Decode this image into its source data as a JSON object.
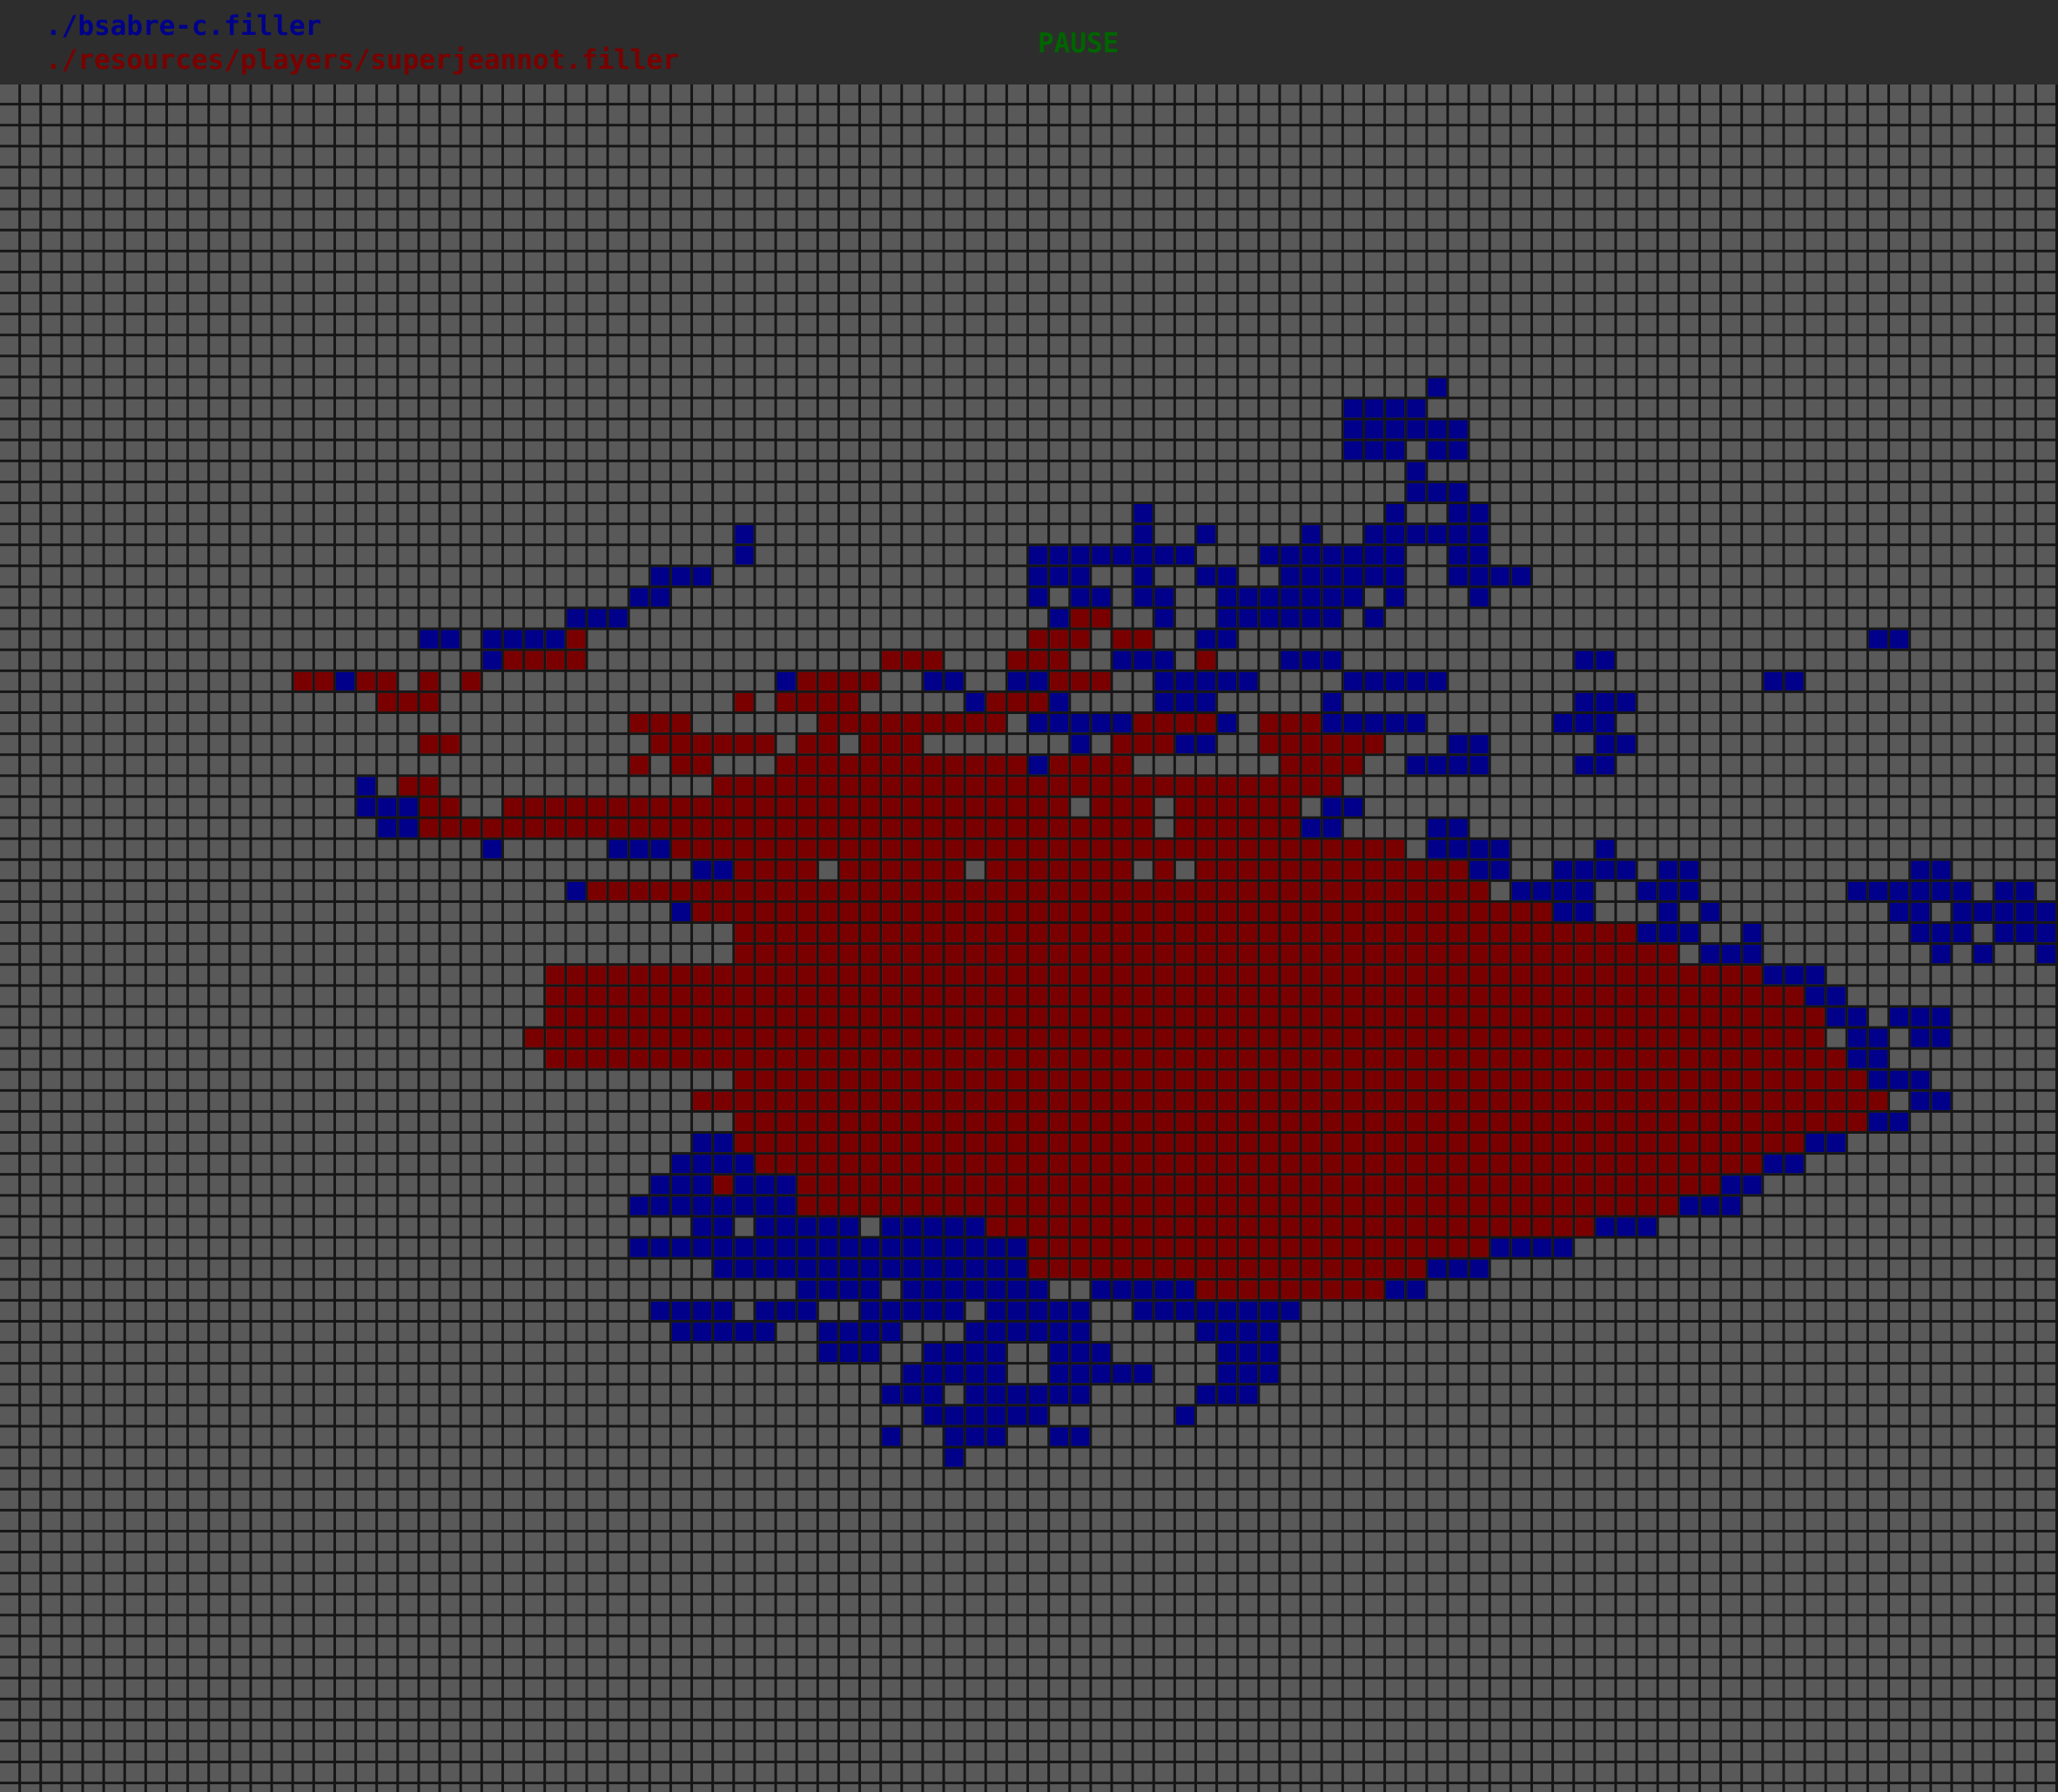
{
  "header": {
    "player1": "./bsabre-c.filler",
    "player2": "./resources/players/superjeannot.filler",
    "status": "PAUSE"
  },
  "colors": {
    "background": "#2d2d2d",
    "empty_cell": "#595959",
    "grid_line": "#161616",
    "player1": "#00008b",
    "player2": "#7a0000",
    "status": "#006400"
  },
  "board": {
    "columns": 98,
    "rows": 81,
    "player1_piece": "O",
    "player2_piece": "X",
    "cells": {
      "14": "....................................................................O.............................",
      "15": "................................................................OOOO..............................",
      "16": "................................................................OOOOOO............................",
      "17": "................................................................OOO.OO............................",
      "18": "...................................................................O..............................",
      "19": "...................................................................OOO............................",
      "20": "......................................................O...........O..OO...........................",
      "21": "...................................O..................O..O....O..OOOOOO...........................",
      "22": "...................................O.............OOOOOOOO...OOOOOOO..OO...........................",
      "23": "...............................OOO...............OOO..O..OO..OOOOOO..OOOO..........................",
      "24": "..............................OO.................O.OO.OO..OOOOOOO.O...O..........................",
      "25": "...........................OOO....................OXX..O..OOOOOO.O..................................",
      "26": "....................OO.OOOOX.....................XXX.XX..OO..............................OO..........",
      "27": ".......................OXXXX..............XXX...XXX..OOO.X...OOO...........OO...............",
      "28": "..............XXOXX.X.X..............OXXXX..OO..OOXXX..OOOOO....OOOOO...............OO...........",
      "29": "..................XXX..............X.XXXX.....OXXXO....OOO.....O...........OOO............",
      "30": "..............................XXX......XXXXXXXXX.OOOOOXXXXO.XXXOOOOO......OOO.....................",
      "31": "....................XX.........XXXXXX.XX.XXX.......O.XXXOO..XXXXXX...OO.....OO.....................",
      "32": "..............................X.XX...XXXXXXXXXXXXOXXXX.......XXXX..OOOO....OO.....................",
      "33": ".................O.XX.............XXXXXXXXXXXXXXXXXXXXXXXXXXXXXX.......................",
      "34": ".................OOOXX..XXXXXXXXXXXXXXXXXXXXXXXXXXX.XXX.XXXXXX.OO......................",
      "35": "..................OOXXXXXXXXXXXXXXXXXXXXXXXXXXXXXXXXXXX.XXXXXXOO....OO.............",
      "36": ".......................O.....OOOXXXXXXXXXXXXXXXXXXXXXXXXXXXXXXXXXXX.OOOO....O......................",
      "37": ".................................OOXXXX.XXXXXX.XXXXXXX.X.XXXXXXXXXXXXXOO..OOOO.OO..........OO......O",
      "38": "...........................OXXXXXXXXXXXXXXXXXXXXXXXXXXXXXXXXXXXXXXXXXXX.OOOO..OOO.......OOOOOO.OO",
      "39": "................................OXXXXXXXXXXXXXXXXXXXXXXXXXXXXXXXXXXXXXXXXXOO...O.O........OO.OOOOOOO",
      "40": "...................................XXXXXXXXXXXXXXXXXXXXXXXXXXXXXXXXXXXXXXXXXXXOOO..O.......OOO.OOOOO",
      "41": "...................................XXXXXXXXXXXXXXXXXXXXXXXXXXXXXXXXXXXXXXXXXXXXX.OOO........O.O..OOO",
      "42": "..........................XXXXXXXXXXXXXXXXXXXXXXXXXXXXXXXXXXXXXXXXXXXXXXXXXXXXXXXXXXOOO...........",
      "43": "..........................XXXXXXXXXXXXXXXXXXXXXXXXXXXXXXXXXXXXXXXXXXXXXXXXXXXXXXXXXXXXOO.........",
      "44": "..........................XXXXXXXXXXXXXXXXXXXXXXXXXXXXXXXXXXXXXXXXXXXXXXXXXXXXXXXXXXXXXOO.OOO...",
      "45": ".........................XXXXXXXXXXXXXXXXXXXXXXXXXXXXXXXXXXXXXXXXXXXXXXXXXXXXXXXXXXXXXX.OO.OO.",
      "46": "..........................XXXXXXXXXXXXXXXXXXXXXXXXXXXXXXXXXXXXXXXXXXXXXXXXXXXXXXXXXXXXXXOO..",
      "47": "...................................XXXXXXXXXXXXXXXXXXXXXXXXXXXXXXXXXXXXXXXXXXXXXXXXXXXXXXOOO.",
      "48": ".................................XXXXXXXXXXXXXXXXXXXXXXXXXXXXXXXXXXXXXXXXXXXXXXXXXXXXXXXXX.OO",
      "49": "...................................XXXXXXXXXXXXXXXXXXXXXXXXXXXXXXXXXXXXXXXXXXXXXXXXXXXXXXOO",
      "50": ".................................OOXXXXXXXXXXXXXXXXXXXXXXXXXXXXXXXXXXXXXXXXXXXXXXXXXXXOO",
      "51": "................................OOOOXXXXXXXXXXXXXXXXXXXXXXXXXXXXXXXXXXXXXXXXXXXXXXXXOO",
      "52": "...............................OOOXOOOXXXXXXXXXXXXXXXXXXXXXXXXXXXXXXXXXXXXXXXXXXXXOO",
      "53": "..............................OOOOOOOOXXXXXXXXXXXXXXXXXXXXXXXXXXXXXXXXXXXXXXXXXXOOO",
      "54": ".................................OO.OOOOO.OOOOOXXXXXXXXXXXXXXXXXXXXXXXXXXXXXOOO",
      "55": "..............................OOOOOOOOOOOOOOOOOOOXXXXXXXXXXXXXXXXXXXXXXOOOO",
      "56": "..................................OOOOOOOOOOOOOOOXXXXXXXXXXXXXXXXXXXOOO",
      "57": "......................................OOOO.OOOOOOO..OOOOOXXXXXXXXXOO",
      "58": "...............................OOOO.OOO..OOOOO.OOOOO..OOOOOOOO.",
      "59": "................................OOOOO..OOOO...OOOOOO.....OOOO.",
      "60": ".......................................OOO..OOOO..OOO.....OOO.",
      "61": "...........................................OOOOO..OOOOO...OOO",
      "62": "..........................................OOO.OOOOOO.....OOO",
      "63": "............................................OOOOOO......O",
      "64": "..........................................O..OOO..OO",
      "65": ".............................................O"
    }
  }
}
